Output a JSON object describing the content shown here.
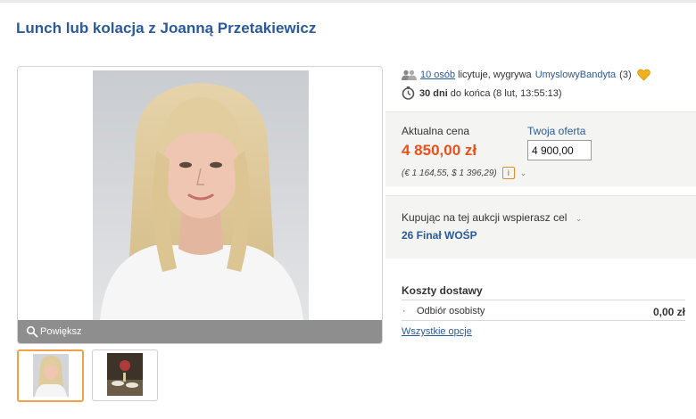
{
  "auction": {
    "title": "Lunch lub kolacja z Joanną Przetakiewicz"
  },
  "gallery": {
    "zoom_label": "Powiększ",
    "thumbnails": [
      "portrait-thumbnail",
      "dinner-table-thumbnail"
    ]
  },
  "bidding": {
    "bidders_count": "10 osób",
    "bidding_text": "licytuje, wygrywa",
    "winner": "UmyslowyBandyta",
    "winner_score": "(3)",
    "days_left": "30 dni",
    "until_text": "do końca (8 lut, 13:55:13)"
  },
  "price": {
    "current_label": "Aktualna cena",
    "current_value": "4 850,00 zł",
    "conversion": "(€ 1 164,55, $ 1 396,29)",
    "info_icon": "i",
    "offer_label": "Twoja oferta",
    "offer_value": "4 900,00"
  },
  "charity": {
    "label": "Kupując na tej aukcji wspierasz cel",
    "value": "26 Finał WOŚP"
  },
  "shipping": {
    "title": "Koszty dostawy",
    "options": [
      {
        "name": "Odbiór osobisty",
        "cost": "0,00 zł"
      }
    ],
    "all_options_link": "Wszystkie opcje"
  },
  "icons": {
    "people": "people-icon",
    "clock": "clock-icon",
    "heart": "heart-icon",
    "zoom": "magnifier-icon"
  },
  "colors": {
    "link": "#2a5a9b",
    "price": "#e8501c",
    "panel": "#f4f4f2",
    "accent": "#f0a04b"
  }
}
